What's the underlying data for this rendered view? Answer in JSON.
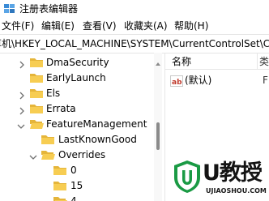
{
  "window": {
    "title": "注册表编辑器"
  },
  "menu": [
    "文件(F)",
    "编辑(E)",
    "查看(V)",
    "收藏夹(A)",
    "帮助(H)"
  ],
  "address": {
    "path": "计算机\\HKEY_LOCAL_MACHINE\\SYSTEM\\CurrentControlSet\\C"
  },
  "tree": {
    "items": [
      {
        "label": "DmaSecurity",
        "expander": "collapsed"
      },
      {
        "label": "EarlyLaunch",
        "expander": "none"
      },
      {
        "label": "Els",
        "expander": "collapsed"
      },
      {
        "label": "Errata",
        "expander": "collapsed"
      },
      {
        "label": "FeatureManagement",
        "expander": "expanded"
      },
      {
        "label": "LastKnownGood",
        "expander": "none"
      },
      {
        "label": "Overrides",
        "expander": "expanded"
      },
      {
        "label": "0",
        "expander": "none"
      },
      {
        "label": "15",
        "expander": "none"
      },
      {
        "label": "4",
        "expander": "expanded"
      }
    ]
  },
  "values_pane": {
    "columns": {
      "name": "名称",
      "type": "类"
    },
    "rows": [
      {
        "name": "(默认)",
        "type": "F"
      }
    ]
  },
  "watermark": {
    "brand": "U教授",
    "url": "UJIAOSHOU.COM"
  },
  "colors": {
    "folder": "#f7cd52",
    "folder_dark": "#e5b53a",
    "accent_green": "#1a9a44"
  }
}
